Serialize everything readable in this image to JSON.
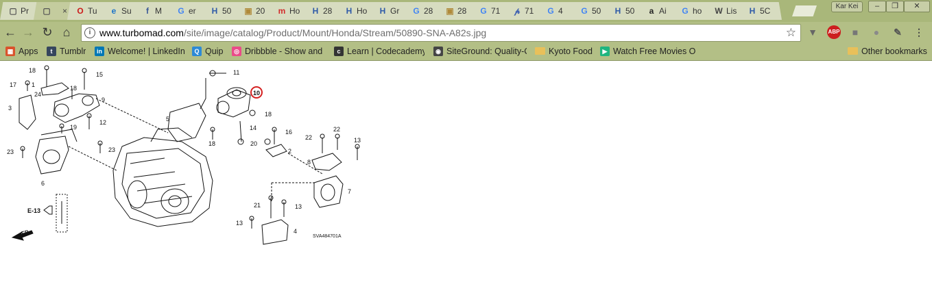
{
  "tabs": [
    {
      "icon": "page-icon",
      "glyph": "▢",
      "color": "#555555",
      "label": "Pr"
    },
    {
      "icon": "page-icon",
      "glyph": "▢",
      "color": "#555555",
      "label": "",
      "active": true,
      "close": "×"
    },
    {
      "icon": "opera-icon",
      "glyph": "O",
      "color": "#cc1a1a",
      "label": "Tu"
    },
    {
      "icon": "ie-icon",
      "glyph": "e",
      "color": "#1a73c8",
      "label": "Su"
    },
    {
      "icon": "facebook-icon",
      "glyph": "f",
      "color": "#3b5998",
      "label": "M"
    },
    {
      "icon": "google-icon",
      "glyph": "G",
      "color": "#4285f4",
      "label": "er"
    },
    {
      "icon": "honda-icon",
      "glyph": "H",
      "color": "#2e5aa8",
      "label": "50"
    },
    {
      "icon": "gift-icon",
      "glyph": "▣",
      "color": "#b08a3a",
      "label": "20"
    },
    {
      "icon": "m-icon",
      "glyph": "m",
      "color": "#d22a2a",
      "label": "Ho"
    },
    {
      "icon": "honda-icon",
      "glyph": "H",
      "color": "#2e5aa8",
      "label": "28"
    },
    {
      "icon": "honda-icon",
      "glyph": "H",
      "color": "#2e5aa8",
      "label": "Ho"
    },
    {
      "icon": "honda-icon",
      "glyph": "H",
      "color": "#2e5aa8",
      "label": "Gr"
    },
    {
      "icon": "google-icon",
      "glyph": "G",
      "color": "#4285f4",
      "label": "28"
    },
    {
      "icon": "gift-icon",
      "glyph": "▣",
      "color": "#b08a3a",
      "label": "28"
    },
    {
      "icon": "google-icon",
      "glyph": "G",
      "color": "#4285f4",
      "label": "71"
    },
    {
      "icon": "p-icon",
      "glyph": "𝓅",
      "color": "#3d5fb0",
      "label": "71"
    },
    {
      "icon": "google-icon",
      "glyph": "G",
      "color": "#4285f4",
      "label": "4"
    },
    {
      "icon": "google-icon",
      "glyph": "G",
      "color": "#4285f4",
      "label": "50"
    },
    {
      "icon": "honda-icon",
      "glyph": "H",
      "color": "#2e5aa8",
      "label": "50"
    },
    {
      "icon": "amazon-icon",
      "glyph": "a",
      "color": "#222222",
      "label": "Ai"
    },
    {
      "icon": "google-icon",
      "glyph": "G",
      "color": "#4285f4",
      "label": "ho"
    },
    {
      "icon": "wikipedia-icon",
      "glyph": "W",
      "color": "#444444",
      "label": "Lis"
    },
    {
      "icon": "honda-icon",
      "glyph": "H",
      "color": "#2e5aa8",
      "label": "5C"
    }
  ],
  "profile_name": "Kar Kei",
  "window_controls": {
    "minimize": "–",
    "maximize": "❐",
    "close": "✕"
  },
  "nav": {
    "back": "←",
    "forward": "→",
    "reload": "↻",
    "home": "⌂"
  },
  "address": {
    "info": "i",
    "host": "www.turbomad.com",
    "path": "/site/image/catalog/Product/Mount/Honda/Stream/50890-SNA-A82s.jpg",
    "star": "☆"
  },
  "extensions": [
    {
      "name": "pocket-icon",
      "label": "▼",
      "color": "#666666"
    },
    {
      "name": "adblock-icon",
      "label": "ABP",
      "color": "#cc1f1f"
    },
    {
      "name": "extension-icon",
      "label": "■",
      "color": "#777777"
    },
    {
      "name": "circle-extension-icon",
      "label": "●",
      "color": "#8a8a8a"
    },
    {
      "name": "eyedropper-icon",
      "label": "✎",
      "color": "#555555"
    },
    {
      "name": "menu-icon",
      "label": "⋮",
      "color": "#444444"
    }
  ],
  "bookmarks": [
    {
      "name": "apps",
      "label": "Apps",
      "icon": "apps-grid-icon",
      "glyph": "▦",
      "color": "#d9532c"
    },
    {
      "name": "tumblr",
      "label": "Tumblr",
      "icon": "tumblr-icon",
      "glyph": "t",
      "color": "#36465d"
    },
    {
      "name": "linkedin",
      "label": "Welcome! | LinkedIn",
      "icon": "linkedin-icon",
      "glyph": "in",
      "color": "#0077b5"
    },
    {
      "name": "quip",
      "label": "Quip",
      "icon": "quip-icon",
      "glyph": "Q",
      "color": "#2d8ad6"
    },
    {
      "name": "dribbble",
      "label": "Dribbble - Show and",
      "icon": "dribbble-icon",
      "glyph": "◎",
      "color": "#ea4c89"
    },
    {
      "name": "codecademy",
      "label": "Learn | Codecademy",
      "icon": "codecademy-icon",
      "glyph": "c",
      "color": "#333333"
    },
    {
      "name": "siteground",
      "label": "SiteGround: Quality-C",
      "icon": "siteground-icon",
      "glyph": "◉",
      "color": "#444444"
    },
    {
      "name": "kyoto-food",
      "label": "Kyoto Food",
      "icon": "folder-icon",
      "glyph": "",
      "color": "#e8c05a"
    },
    {
      "name": "watch-free-movies",
      "label": "Watch Free Movies O",
      "icon": "play-icon",
      "glyph": "▶",
      "color": "#1fb57f"
    }
  ],
  "other_bookmarks": "Other bookmarks",
  "diagram": {
    "callouts": [
      "18",
      "15",
      "17",
      "1",
      "18",
      "24",
      "9",
      "3",
      "19",
      "12",
      "23",
      "23",
      "6",
      "11",
      "10",
      "18",
      "5",
      "14",
      "18",
      "16",
      "20",
      "2",
      "22",
      "22",
      "13",
      "8",
      "7",
      "21",
      "13",
      "13",
      "4"
    ],
    "section_ref": "E-13",
    "direction": "FR.",
    "part_code": "SVA484701A"
  }
}
